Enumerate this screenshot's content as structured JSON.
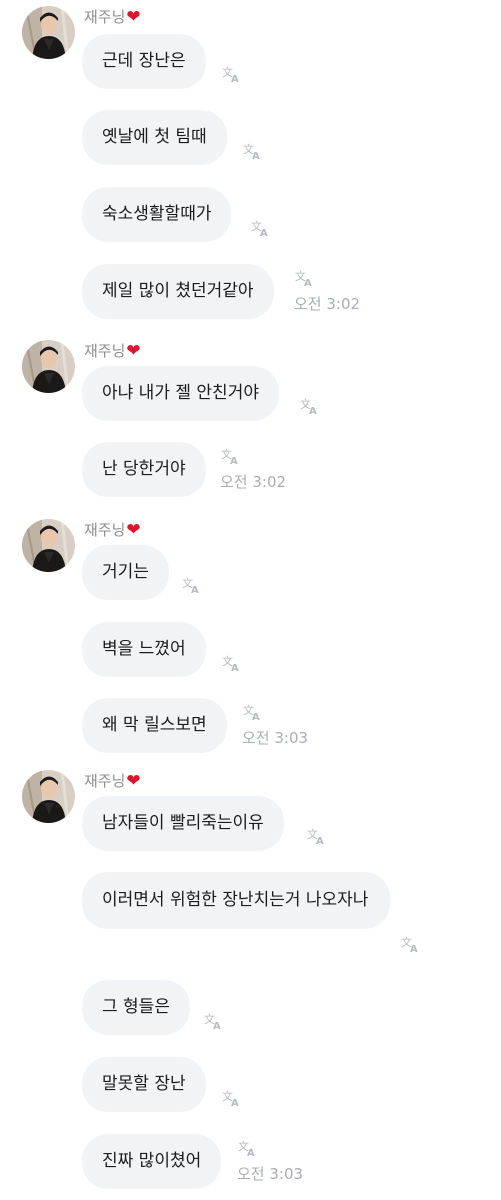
{
  "sender_name": "재주닝",
  "heart_glyph": "❤",
  "messages": [
    "근데 장난은",
    "옛날에 첫 팀때",
    "숙소생활할때가",
    "제일 많이 쳤던거같아",
    "아냐 내가 젤 안친거야",
    "난 당한거야",
    "거기는",
    "벽을 느꼈어",
    "왜 막 릴스보면",
    "남자들이 빨리죽는이유",
    "이러면서 위험한 장난치는거 나오자나",
    "그 형들은",
    "말못할 장난",
    "진짜 많이쳤어"
  ],
  "times": [
    "오전 3:02",
    "오전 3:02",
    "오전 3:03",
    "오전 3:03"
  ],
  "icons": {
    "translate": "translate-icon",
    "avatar": "profile-photo"
  },
  "colors": {
    "bubble": "#f2f3f5",
    "heart": "#e0142b",
    "meta": "#a9acb3"
  }
}
